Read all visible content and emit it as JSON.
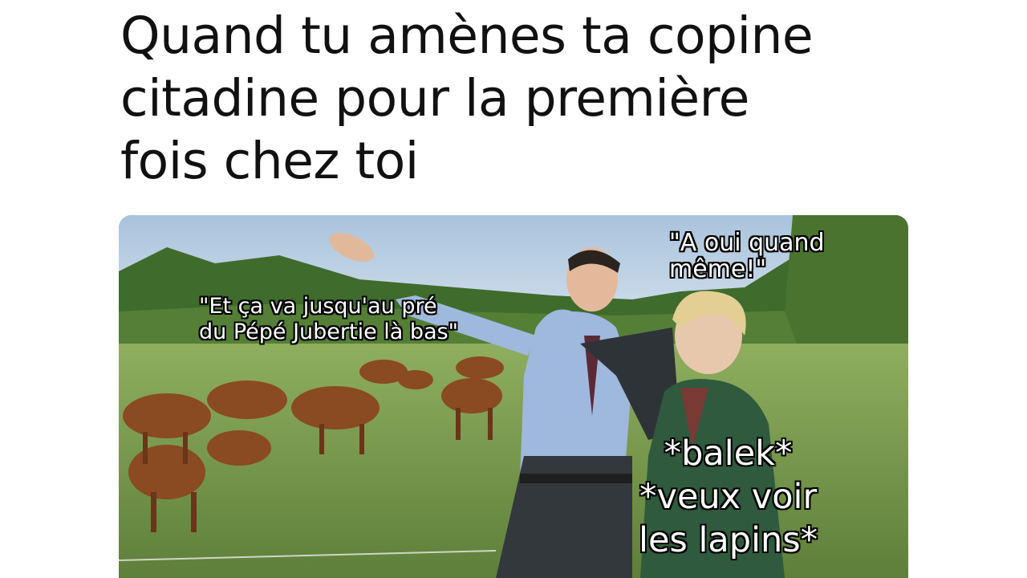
{
  "caption": {
    "lines": [
      "Quand tu amènes ta copine",
      "citadine pour la première",
      "fois chez toi"
    ]
  },
  "photo": {
    "description_icon": "countryside-photo",
    "overlays": {
      "man_quote": [
        "\"Et ça va jusqu'au pré",
        "du Pépé Jubertie là bas\""
      ],
      "woman_quote": [
        "\"A oui quand",
        "même!\""
      ],
      "woman_thought": [
        "*balek*",
        "*veux voir",
        "les lapins*"
      ]
    }
  },
  "colors": {
    "background": "#ffffff",
    "caption_text": "#111111",
    "overlay_text": "#ffffff",
    "overlay_outline": "#000000"
  }
}
